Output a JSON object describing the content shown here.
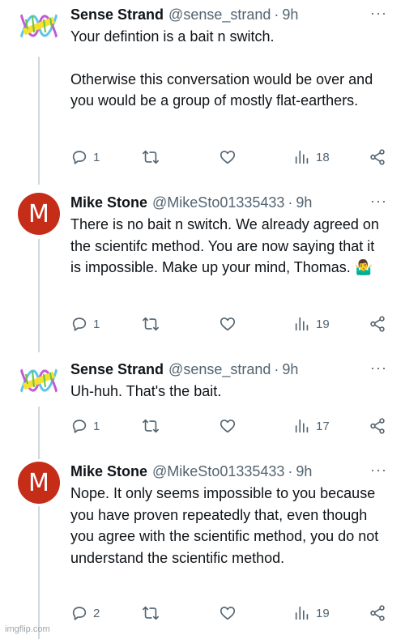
{
  "tweets": [
    {
      "author": "Sense Strand",
      "handle": "@sense_strand",
      "separator": "·",
      "time": "9h",
      "avatar_letter": "",
      "paragraphs": [
        "Your defintion is a bait n switch.",
        "Otherwise this conversation would be over and you would be a group of mostly flat-earthers."
      ],
      "more": "···",
      "replies": "1",
      "retweets": "",
      "likes": "",
      "views": "18"
    },
    {
      "author": "Mike Stone",
      "handle": "@MikeSto01335433",
      "separator": "·",
      "time": "9h",
      "avatar_letter": "M",
      "paragraphs": [
        "There is no bait n switch. We already agreed on the scientifc method. You are now saying that it is impossible. Make up your mind, Thomas. 🤷‍♂️"
      ],
      "more": "···",
      "replies": "1",
      "retweets": "",
      "likes": "",
      "views": "19"
    },
    {
      "author": "Sense Strand",
      "handle": "@sense_strand",
      "separator": "·",
      "time": "9h",
      "avatar_letter": "",
      "paragraphs": [
        "Uh-huh. That's the bait."
      ],
      "more": "···",
      "replies": "1",
      "retweets": "",
      "likes": "",
      "views": "17"
    },
    {
      "author": "Mike Stone",
      "handle": "@MikeSto01335433",
      "separator": "·",
      "time": "9h",
      "avatar_letter": "M",
      "paragraphs": [
        "Nope. It only seems impossible to you because you have proven repeatedly that, even though you agree with the scientific method, you do not understand the scientific method."
      ],
      "more": "···",
      "replies": "2",
      "retweets": "",
      "likes": "",
      "views": "19"
    }
  ],
  "icons": {
    "reply": "reply-icon",
    "retweet": "retweet-icon",
    "like": "heart-icon",
    "views": "views-icon",
    "share": "share-icon",
    "more": "more-icon"
  },
  "colors": {
    "text": "#0f1419",
    "muted": "#536471",
    "thread_line": "#cfd9de",
    "avatar_m": "#c62d19"
  },
  "watermark": "imgflip.com"
}
